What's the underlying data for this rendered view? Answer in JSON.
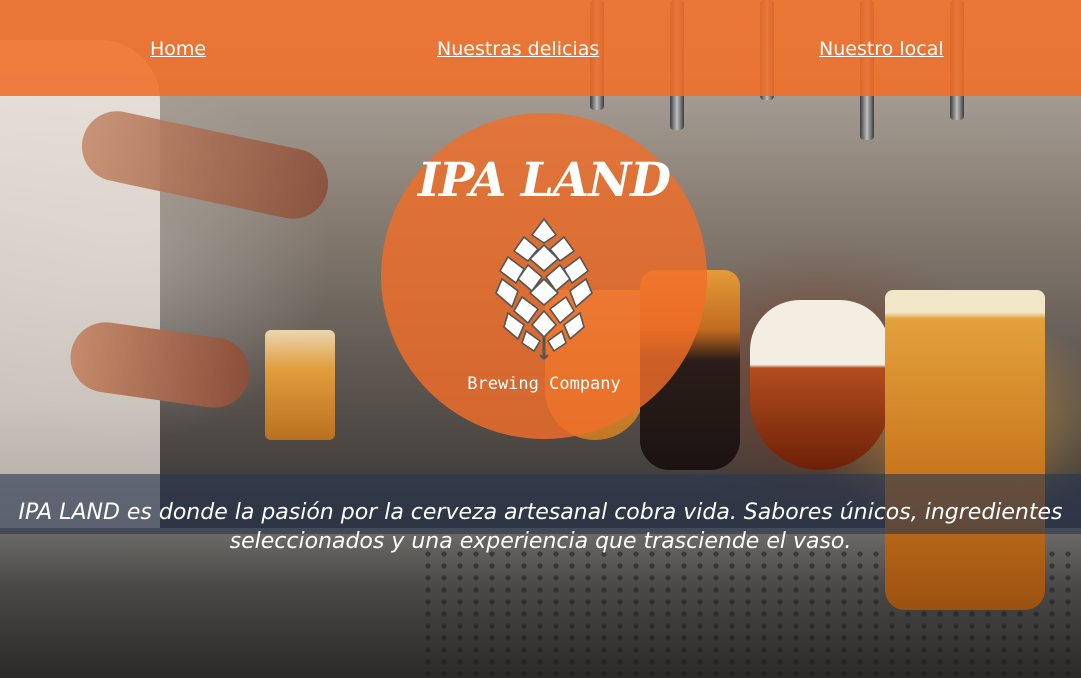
{
  "nav": {
    "items": [
      {
        "label": "Home"
      },
      {
        "label": "Nuestras delicias"
      },
      {
        "label": "Nuestro local"
      }
    ]
  },
  "hero": {
    "brand": "IPA LAND",
    "logo_icon": "hop-cone-icon",
    "tagline": "Brewing Company",
    "description": "IPA LAND es donde la pasión por la cerveza artesanal cobra vida. Sabores únicos, ingredientes seleccionados y una experiencia que trasciende el vaso."
  },
  "colors": {
    "accent": "#f06e28",
    "band": "#283750",
    "text": "#ffffff"
  }
}
